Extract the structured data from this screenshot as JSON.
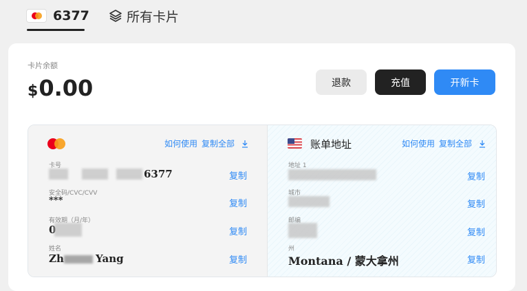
{
  "tabs": {
    "card_number": "6377",
    "all_cards": "所有卡片"
  },
  "balance": {
    "label": "卡片余额",
    "currency": "$",
    "amount": "0.00"
  },
  "actions": {
    "refund": "退款",
    "topup": "充值",
    "new_card": "开新卡"
  },
  "card_panel": {
    "how_to_use": "如何使用",
    "copy_all": "复制全部",
    "fields": [
      {
        "label": "卡号",
        "value": "6377",
        "copy": "复制"
      },
      {
        "label": "安全码/CVC/CVV",
        "value": "***",
        "copy": "复制"
      },
      {
        "label": "有效期（月/年）",
        "value": "0",
        "copy": "复制"
      },
      {
        "label": "姓名",
        "value_prefix": "Zh",
        "value_suffix": "Yang",
        "copy": "复制"
      }
    ]
  },
  "billing_panel": {
    "title": "账单地址",
    "how_to_use": "如何使用",
    "copy_all": "复制全部",
    "fields": [
      {
        "label": "地址 1",
        "value": "",
        "copy": "复制"
      },
      {
        "label": "城市",
        "value": "",
        "copy": "复制"
      },
      {
        "label": "邮编",
        "value": "",
        "copy": "复制"
      },
      {
        "label": "州",
        "value": "Montana / 蒙大拿州",
        "copy": "复制"
      }
    ]
  }
}
